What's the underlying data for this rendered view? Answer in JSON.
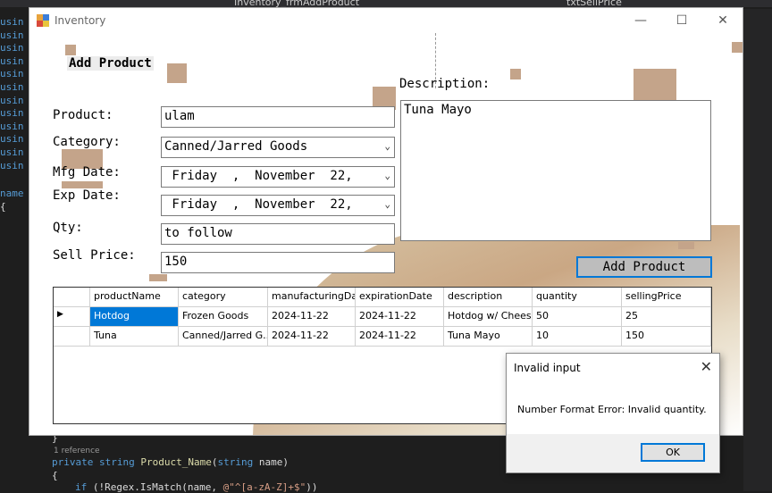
{
  "ide": {
    "tab1": "Inventory_frmAddProduct",
    "tab2": "txtSellPrice",
    "left_lines": [
      "usin",
      "usin",
      "usin",
      "usin",
      "usin",
      "usin",
      "usin",
      "usin",
      "usin",
      "usin",
      "usin",
      "usin"
    ],
    "name_kw": "name",
    "brace": "{",
    "code": {
      "close_brace": "}",
      "reference": "1 reference",
      "kw_private": "private",
      "kw_string": "string",
      "method": "Product_Name",
      "param_type": "string",
      "param": "name)",
      "open_brace": "{",
      "if_kw": "if",
      "regex_call": "(!Regex.IsMatch(name, ",
      "pattern": "@\"^[a-zA-Z]+$\"",
      "close": "))"
    }
  },
  "window": {
    "title": "Inventory",
    "minimize": "—",
    "maximize": "☐",
    "close": "✕"
  },
  "form": {
    "heading": "Add Product",
    "labels": {
      "product": "Product:",
      "category": "Category:",
      "mfg_date": "Mfg Date:",
      "exp_date": "Exp Date:",
      "qty": "Qty:",
      "sell_price": "Sell Price:",
      "description": "Description:"
    },
    "values": {
      "product": "ulam",
      "category": "Canned/Jarred Goods",
      "mfg_date": " Friday  ,  November  22,",
      "exp_date": " Friday  ,  November  22,",
      "qty": "to follow",
      "sell_price": "150",
      "description": "Tuna Mayo"
    },
    "add_button": "Add Product"
  },
  "grid": {
    "columns": [
      "productName",
      "category",
      "manufacturingDate",
      "expirationDate",
      "description",
      "quantity",
      "sellingPrice"
    ],
    "rows": [
      [
        "Hotdog",
        "Frozen Goods",
        "2024-11-22",
        "2024-11-22",
        "Hotdog w/ Cheese",
        "50",
        "25"
      ],
      [
        "Tuna",
        "Canned/Jarred G...",
        "2024-11-22",
        "2024-11-22",
        "Tuna Mayo",
        "10",
        "150"
      ]
    ],
    "row_indicator": "▶"
  },
  "dialog": {
    "title": "Invalid input",
    "close": "✕",
    "message": "Number Format Error: Invalid quantity.",
    "ok": "OK"
  },
  "colors": {
    "accent": "#0078d7",
    "deco": "#c4a48a"
  }
}
